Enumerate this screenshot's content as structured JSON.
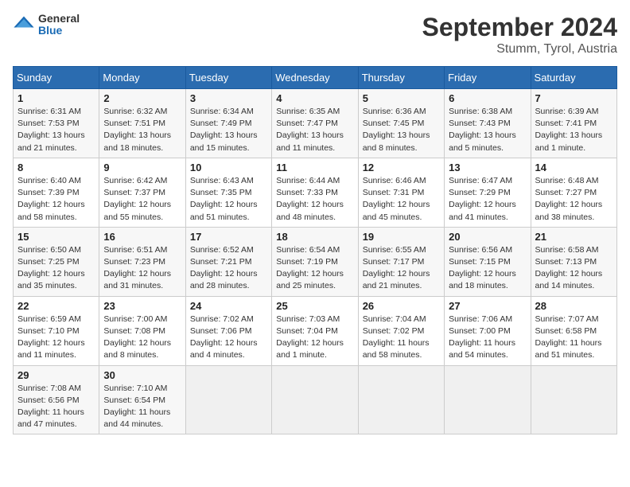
{
  "header": {
    "logo": {
      "general": "General",
      "blue": "Blue"
    },
    "title": "September 2024",
    "subtitle": "Stumm, Tyrol, Austria"
  },
  "weekdays": [
    "Sunday",
    "Monday",
    "Tuesday",
    "Wednesday",
    "Thursday",
    "Friday",
    "Saturday"
  ],
  "weeks": [
    [
      {
        "day": "1",
        "sunrise": "Sunrise: 6:31 AM",
        "sunset": "Sunset: 7:53 PM",
        "daylight": "Daylight: 13 hours and 21 minutes."
      },
      {
        "day": "2",
        "sunrise": "Sunrise: 6:32 AM",
        "sunset": "Sunset: 7:51 PM",
        "daylight": "Daylight: 13 hours and 18 minutes."
      },
      {
        "day": "3",
        "sunrise": "Sunrise: 6:34 AM",
        "sunset": "Sunset: 7:49 PM",
        "daylight": "Daylight: 13 hours and 15 minutes."
      },
      {
        "day": "4",
        "sunrise": "Sunrise: 6:35 AM",
        "sunset": "Sunset: 7:47 PM",
        "daylight": "Daylight: 13 hours and 11 minutes."
      },
      {
        "day": "5",
        "sunrise": "Sunrise: 6:36 AM",
        "sunset": "Sunset: 7:45 PM",
        "daylight": "Daylight: 13 hours and 8 minutes."
      },
      {
        "day": "6",
        "sunrise": "Sunrise: 6:38 AM",
        "sunset": "Sunset: 7:43 PM",
        "daylight": "Daylight: 13 hours and 5 minutes."
      },
      {
        "day": "7",
        "sunrise": "Sunrise: 6:39 AM",
        "sunset": "Sunset: 7:41 PM",
        "daylight": "Daylight: 13 hours and 1 minute."
      }
    ],
    [
      {
        "day": "8",
        "sunrise": "Sunrise: 6:40 AM",
        "sunset": "Sunset: 7:39 PM",
        "daylight": "Daylight: 12 hours and 58 minutes."
      },
      {
        "day": "9",
        "sunrise": "Sunrise: 6:42 AM",
        "sunset": "Sunset: 7:37 PM",
        "daylight": "Daylight: 12 hours and 55 minutes."
      },
      {
        "day": "10",
        "sunrise": "Sunrise: 6:43 AM",
        "sunset": "Sunset: 7:35 PM",
        "daylight": "Daylight: 12 hours and 51 minutes."
      },
      {
        "day": "11",
        "sunrise": "Sunrise: 6:44 AM",
        "sunset": "Sunset: 7:33 PM",
        "daylight": "Daylight: 12 hours and 48 minutes."
      },
      {
        "day": "12",
        "sunrise": "Sunrise: 6:46 AM",
        "sunset": "Sunset: 7:31 PM",
        "daylight": "Daylight: 12 hours and 45 minutes."
      },
      {
        "day": "13",
        "sunrise": "Sunrise: 6:47 AM",
        "sunset": "Sunset: 7:29 PM",
        "daylight": "Daylight: 12 hours and 41 minutes."
      },
      {
        "day": "14",
        "sunrise": "Sunrise: 6:48 AM",
        "sunset": "Sunset: 7:27 PM",
        "daylight": "Daylight: 12 hours and 38 minutes."
      }
    ],
    [
      {
        "day": "15",
        "sunrise": "Sunrise: 6:50 AM",
        "sunset": "Sunset: 7:25 PM",
        "daylight": "Daylight: 12 hours and 35 minutes."
      },
      {
        "day": "16",
        "sunrise": "Sunrise: 6:51 AM",
        "sunset": "Sunset: 7:23 PM",
        "daylight": "Daylight: 12 hours and 31 minutes."
      },
      {
        "day": "17",
        "sunrise": "Sunrise: 6:52 AM",
        "sunset": "Sunset: 7:21 PM",
        "daylight": "Daylight: 12 hours and 28 minutes."
      },
      {
        "day": "18",
        "sunrise": "Sunrise: 6:54 AM",
        "sunset": "Sunset: 7:19 PM",
        "daylight": "Daylight: 12 hours and 25 minutes."
      },
      {
        "day": "19",
        "sunrise": "Sunrise: 6:55 AM",
        "sunset": "Sunset: 7:17 PM",
        "daylight": "Daylight: 12 hours and 21 minutes."
      },
      {
        "day": "20",
        "sunrise": "Sunrise: 6:56 AM",
        "sunset": "Sunset: 7:15 PM",
        "daylight": "Daylight: 12 hours and 18 minutes."
      },
      {
        "day": "21",
        "sunrise": "Sunrise: 6:58 AM",
        "sunset": "Sunset: 7:13 PM",
        "daylight": "Daylight: 12 hours and 14 minutes."
      }
    ],
    [
      {
        "day": "22",
        "sunrise": "Sunrise: 6:59 AM",
        "sunset": "Sunset: 7:10 PM",
        "daylight": "Daylight: 12 hours and 11 minutes."
      },
      {
        "day": "23",
        "sunrise": "Sunrise: 7:00 AM",
        "sunset": "Sunset: 7:08 PM",
        "daylight": "Daylight: 12 hours and 8 minutes."
      },
      {
        "day": "24",
        "sunrise": "Sunrise: 7:02 AM",
        "sunset": "Sunset: 7:06 PM",
        "daylight": "Daylight: 12 hours and 4 minutes."
      },
      {
        "day": "25",
        "sunrise": "Sunrise: 7:03 AM",
        "sunset": "Sunset: 7:04 PM",
        "daylight": "Daylight: 12 hours and 1 minute."
      },
      {
        "day": "26",
        "sunrise": "Sunrise: 7:04 AM",
        "sunset": "Sunset: 7:02 PM",
        "daylight": "Daylight: 11 hours and 58 minutes."
      },
      {
        "day": "27",
        "sunrise": "Sunrise: 7:06 AM",
        "sunset": "Sunset: 7:00 PM",
        "daylight": "Daylight: 11 hours and 54 minutes."
      },
      {
        "day": "28",
        "sunrise": "Sunrise: 7:07 AM",
        "sunset": "Sunset: 6:58 PM",
        "daylight": "Daylight: 11 hours and 51 minutes."
      }
    ],
    [
      {
        "day": "29",
        "sunrise": "Sunrise: 7:08 AM",
        "sunset": "Sunset: 6:56 PM",
        "daylight": "Daylight: 11 hours and 47 minutes."
      },
      {
        "day": "30",
        "sunrise": "Sunrise: 7:10 AM",
        "sunset": "Sunset: 6:54 PM",
        "daylight": "Daylight: 11 hours and 44 minutes."
      },
      null,
      null,
      null,
      null,
      null
    ]
  ]
}
